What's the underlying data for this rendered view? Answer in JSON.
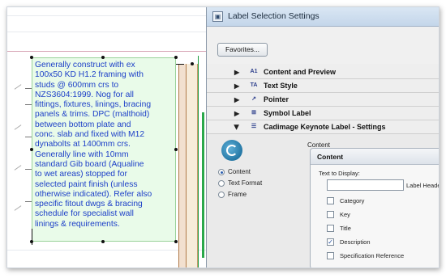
{
  "dialog": {
    "title": "Label Selection Settings",
    "favorites_label": "Favorites...",
    "sections": [
      {
        "label": "Content and Preview",
        "icon": "A1"
      },
      {
        "label": "Text Style",
        "icon": "TA"
      },
      {
        "label": "Pointer",
        "icon": "↗"
      },
      {
        "label": "Symbol Label",
        "icon": "⊞"
      },
      {
        "label": "Cadimage Keynote Label - Settings",
        "icon": "☰"
      }
    ],
    "content_heading": "Content",
    "radios": [
      {
        "label": "Content",
        "selected": true
      },
      {
        "label": "Text Format",
        "selected": false
      },
      {
        "label": "Frame",
        "selected": false
      }
    ],
    "inner_panel": {
      "title": "Content",
      "text_to_display_label": "Text to Display:",
      "text_to_display_value": "",
      "label_header": "Label Header",
      "checkboxes": [
        {
          "label": "Category",
          "checked": false
        },
        {
          "label": "Key",
          "checked": false
        },
        {
          "label": "Title",
          "checked": false
        },
        {
          "label": "Description",
          "checked": true
        },
        {
          "label": "Specification Reference",
          "checked": false
        }
      ]
    }
  },
  "drawing": {
    "label_text": "Generally construct with ex\n100x50 KD H1.2 framing with\nstuds @ 600mm crs to\nNZS3604:1999. Nog for all\nfittings, fixtures, linings, bracing\npanels & trims. DPC (malthoid)\nbetween bottom plate and\nconc. slab and fixed with M12\ndynabolts at 1400mm crs.\nGenerally line with 10mm\nstandard Gib board (Aqualine\nto wet areas) stopped for\nselected paint finish (unless\notherwise indicated). Refer also\nspecific fitout dwgs & bracing\nschedule for specialist wall\nlinings & requirements.",
    "label_color": "#1c3fc8",
    "label_background": "#e9fbe9"
  },
  "check_mark": "✓"
}
